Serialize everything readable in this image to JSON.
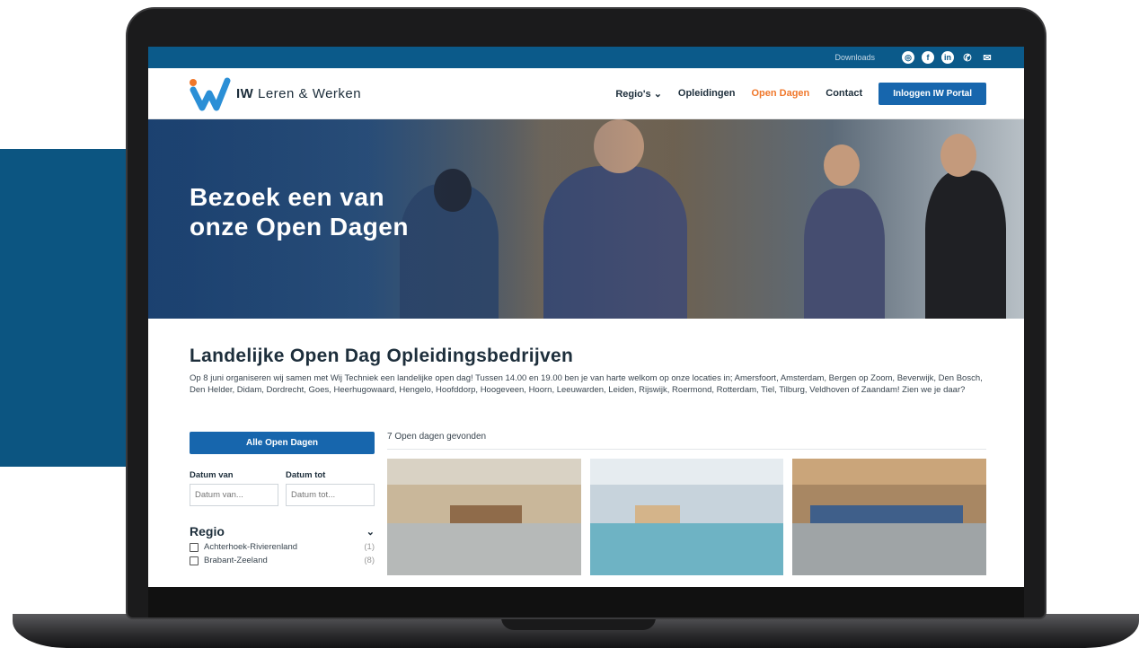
{
  "topbar": {
    "downloads": "Downloads",
    "icons": [
      "instagram-icon",
      "facebook-icon",
      "linkedin-icon",
      "phone-icon",
      "mail-icon"
    ]
  },
  "nav": {
    "brand_bold": "IW",
    "brand_rest": " Leren & Werken",
    "items": [
      {
        "label": "Regio's ⌄"
      },
      {
        "label": "Opleidingen"
      },
      {
        "label": "Open Dagen"
      },
      {
        "label": "Contact"
      }
    ],
    "portal_label": "Inloggen IW Portal"
  },
  "hero": {
    "line1": "Bezoek een van",
    "line2": "onze Open Dagen"
  },
  "intro": {
    "title": "Landelijke Open Dag Opleidingsbedrijven",
    "text": "Op 8 juni organiseren wij samen met Wij Techniek een landelijke open dag! Tussen 14.00 en 19.00 ben je van harte welkom op onze locaties in; Amersfoort, Amsterdam, Bergen op Zoom, Beverwijk, Den Bosch, Den Helder, Didam, Dordrecht, Goes, Heerhugowaard, Hengelo, Hoofddorp, Hoogeveen, Hoorn, Leeuwarden, Leiden, Rijswijk, Roermond, Rotterdam, Tiel, Tilburg, Veldhoven of Zaandam! Zien we je daar?"
  },
  "sidebar": {
    "all_button": "Alle Open Dagen",
    "date_from_label": "Datum van",
    "date_from_placeholder": "Datum van...",
    "date_to_label": "Datum tot",
    "date_to_placeholder": "Datum tot...",
    "regio_title": "Regio",
    "regions": [
      {
        "name": "Achterhoek-Rivierenland",
        "count": "(1)"
      },
      {
        "name": "Brabant-Zeeland",
        "count": "(8)"
      }
    ]
  },
  "results": {
    "found_text": "7 Open dagen gevonden"
  },
  "colors": {
    "primary": "#1766ad",
    "accent": "#f0772a",
    "topbar": "#0b5a8a",
    "panel": "#0c5581"
  }
}
